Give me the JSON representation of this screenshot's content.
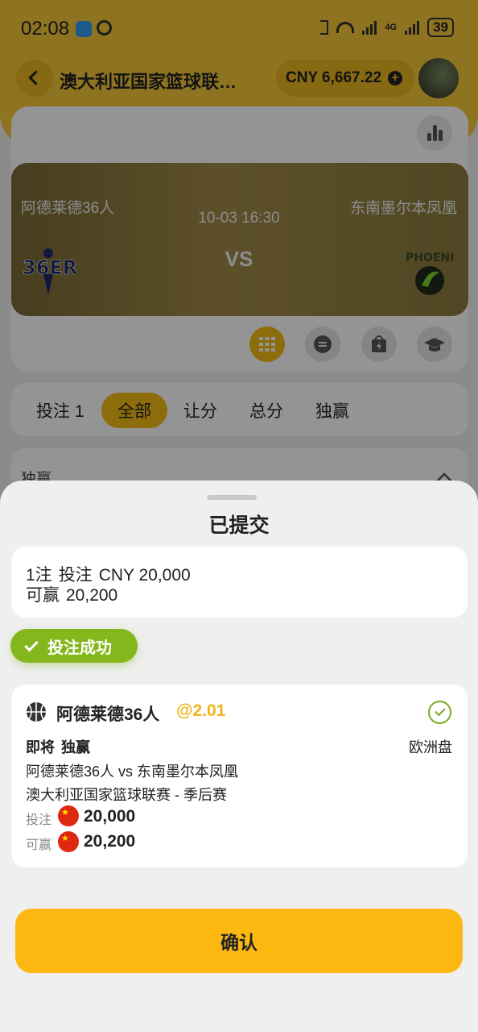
{
  "status_bar": {
    "time": "02:08",
    "network": "4G",
    "battery": "39"
  },
  "header": {
    "title": "澳大利亚国家篮球联…",
    "balance": "CNY 6,667.22"
  },
  "match": {
    "home_team": "阿德莱德36人",
    "away_team": "东南墨尔本凤凰",
    "datetime": "10-03 16:30",
    "vs": "VS"
  },
  "tabs": [
    {
      "label": "投注 1"
    },
    {
      "label": "全部",
      "active": true
    },
    {
      "label": "让分"
    },
    {
      "label": "总分"
    },
    {
      "label": "独赢"
    }
  ],
  "market_section": {
    "label": "独赢"
  },
  "sheet": {
    "title": "已提交",
    "summary": {
      "count": "1注",
      "stake_label": "投注",
      "stake": "CNY 20,000",
      "win_label": "可赢",
      "win": "20,200"
    },
    "success_badge": "投注成功",
    "bet": {
      "selection": "阿德莱德36人",
      "odds": "@2.01",
      "timing": "即将",
      "bet_type": "独赢",
      "market": "欧洲盘",
      "matchup": "阿德莱德36人 vs 东南墨尔本凤凰",
      "league": "澳大利亚国家篮球联赛 - 季后赛",
      "stake_label": "投注",
      "stake_value": "20,000",
      "win_label": "可赢",
      "win_value": "20,200"
    },
    "confirm_button": "确认"
  },
  "colors": {
    "accent": "#fcb811",
    "success": "#84b71c",
    "odds": "#f0b41a"
  },
  "icons": [
    "back-icon",
    "plus-icon",
    "stats-icon",
    "grid-icon",
    "chat-icon",
    "bag-icon",
    "graduation-icon",
    "chevron-up-icon",
    "check-icon",
    "basketball-icon",
    "check-circle-icon",
    "cn-flag-icon"
  ]
}
